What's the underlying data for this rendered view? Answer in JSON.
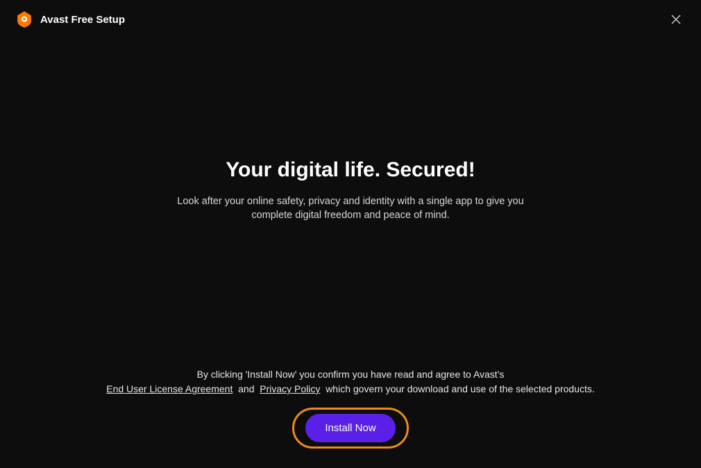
{
  "header": {
    "title": "Avast Free Setup"
  },
  "main": {
    "headline": "Your digital life. Secured!",
    "subtext": "Look after your online safety, privacy and identity with a single app to give you complete digital freedom and peace of mind."
  },
  "agreement": {
    "prefix": "By clicking 'Install Now' you confirm you have read and agree to Avast's",
    "eula": "End User License Agreement",
    "and": "and",
    "privacy": "Privacy Policy",
    "suffix": "which govern your download and use of the selected products."
  },
  "install": {
    "label": "Install Now"
  }
}
